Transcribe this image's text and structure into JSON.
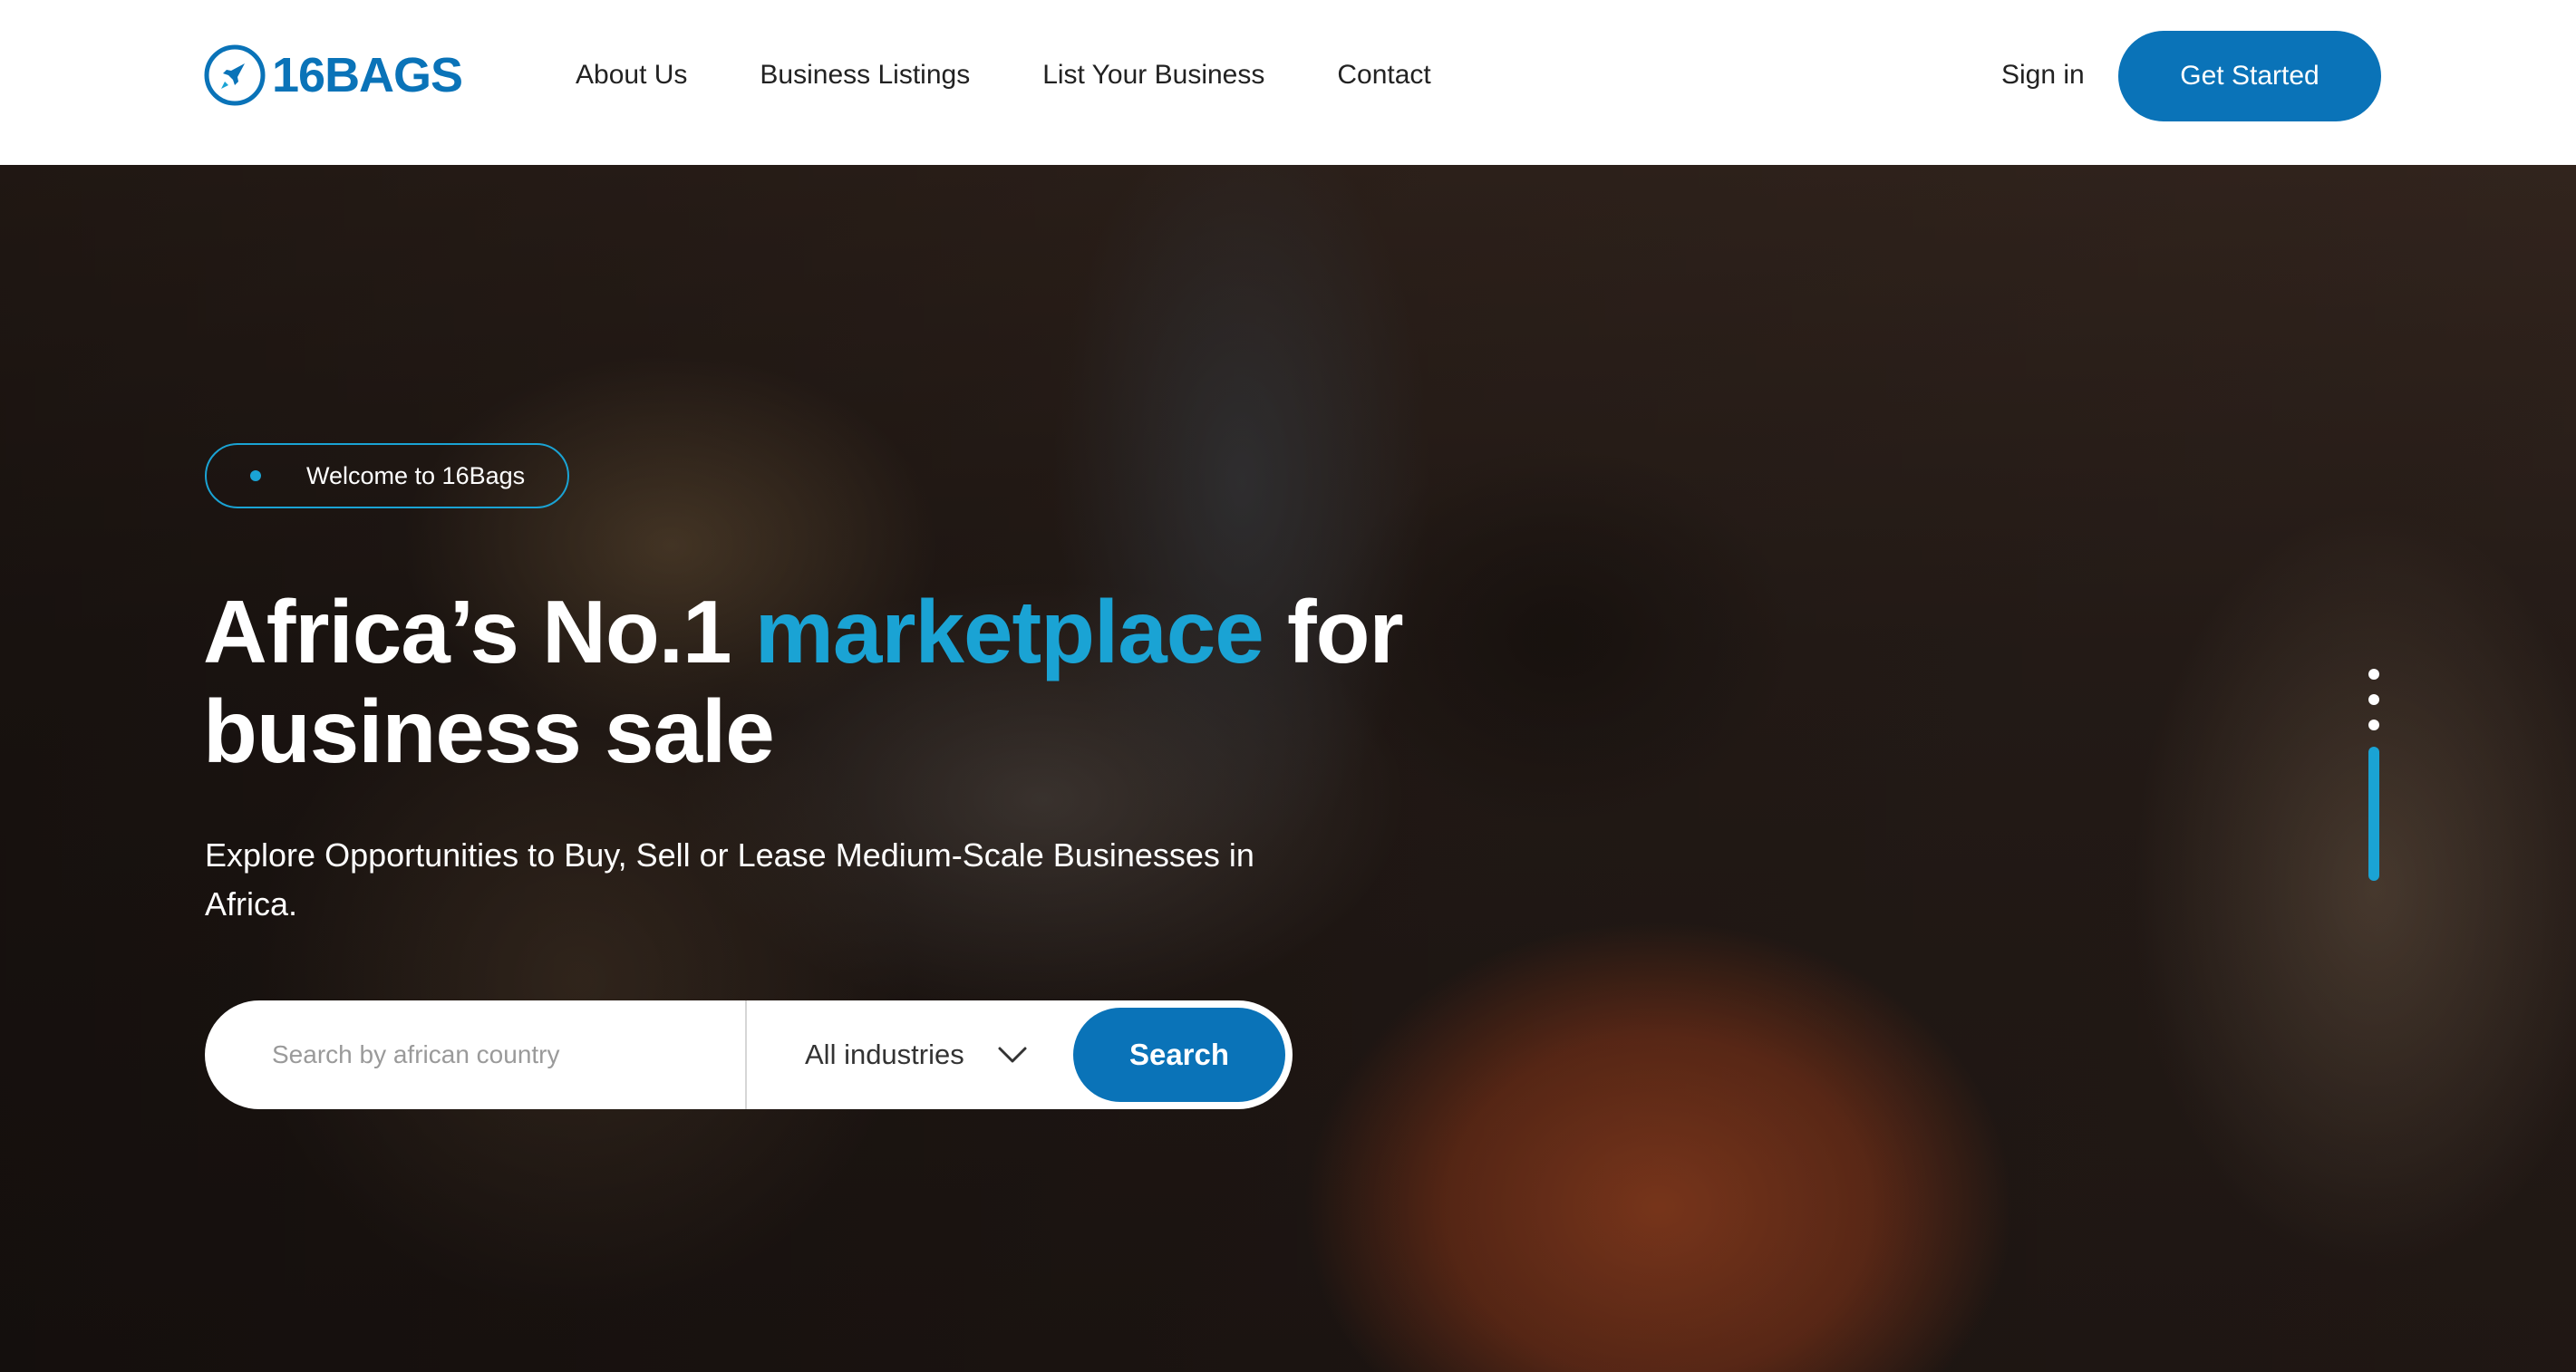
{
  "brand": {
    "name": "16BAGS",
    "primary_color": "#0a73b8",
    "accent_color": "#1aa3d4",
    "logo_icon": "rocket-circle-icon"
  },
  "nav": {
    "items": [
      {
        "label": "About Us"
      },
      {
        "label": "Business Listings"
      },
      {
        "label": "List Your Business"
      },
      {
        "label": "Contact"
      }
    ],
    "signin_label": "Sign in",
    "cta_label": "Get Started"
  },
  "hero": {
    "welcome_label": "Welcome to 16Bags",
    "headline_part1": "Africa’s No.1 ",
    "headline_accent": "marketplace",
    "headline_part2": " for business sale",
    "subheadline": "Explore Opportunities to Buy, Sell or Lease Medium-Scale Businesses in Africa.",
    "search": {
      "placeholder": "Search by african country",
      "industry_value": "All industries",
      "button_label": "Search"
    },
    "slider": {
      "total_slides": 4,
      "active_slide": 4
    }
  }
}
